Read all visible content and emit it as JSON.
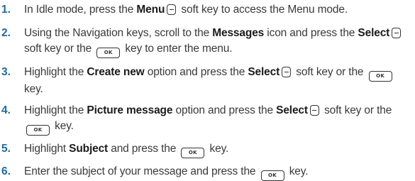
{
  "steps": [
    {
      "number": "1.",
      "segments": [
        {
          "t": "text",
          "v": "In Idle mode, press the "
        },
        {
          "t": "bold",
          "v": "Menu"
        },
        {
          "t": "softkey-icon"
        },
        {
          "t": "text",
          "v": " soft key to access the Menu mode."
        }
      ]
    },
    {
      "number": "2.",
      "segments": [
        {
          "t": "text",
          "v": "Using the Navigation keys, scroll to the "
        },
        {
          "t": "bold",
          "v": "Messages"
        },
        {
          "t": "text",
          "v": " icon and press the "
        },
        {
          "t": "bold",
          "v": "Select"
        },
        {
          "t": "softkey-icon"
        },
        {
          "t": "text",
          "v": " soft key or the "
        },
        {
          "t": "ok-key-icon",
          "v": "OK"
        },
        {
          "t": "text",
          "v": " key to enter the menu."
        }
      ]
    },
    {
      "number": "3.",
      "segments": [
        {
          "t": "text",
          "v": "Highlight the "
        },
        {
          "t": "bold",
          "v": "Create new"
        },
        {
          "t": "text",
          "v": " option and press the "
        },
        {
          "t": "bold",
          "v": "Select"
        },
        {
          "t": "softkey-icon"
        },
        {
          "t": "text",
          "v": " soft key or the "
        },
        {
          "t": "ok-key-icon",
          "v": "OK"
        },
        {
          "t": "text",
          "v": " key."
        }
      ]
    },
    {
      "number": "4.",
      "segments": [
        {
          "t": "text",
          "v": "Highlight the "
        },
        {
          "t": "bold",
          "v": "Picture message"
        },
        {
          "t": "text",
          "v": " option and press the "
        },
        {
          "t": "bold",
          "v": "Select"
        },
        {
          "t": "softkey-icon"
        },
        {
          "t": "text",
          "v": " soft key or the "
        },
        {
          "t": "ok-key-icon",
          "v": "OK"
        },
        {
          "t": "text",
          "v": " key."
        }
      ]
    },
    {
      "number": "5.",
      "segments": [
        {
          "t": "text",
          "v": "Highlight "
        },
        {
          "t": "bold",
          "v": "Subject"
        },
        {
          "t": "text",
          "v": " and press the "
        },
        {
          "t": "ok-key-icon",
          "v": "OK"
        },
        {
          "t": "text",
          "v": " key."
        }
      ]
    },
    {
      "number": "6.",
      "segments": [
        {
          "t": "text",
          "v": "Enter the subject of your message and press the "
        },
        {
          "t": "ok-key-icon",
          "v": "OK"
        },
        {
          "t": "text",
          "v": " key."
        }
      ]
    }
  ]
}
